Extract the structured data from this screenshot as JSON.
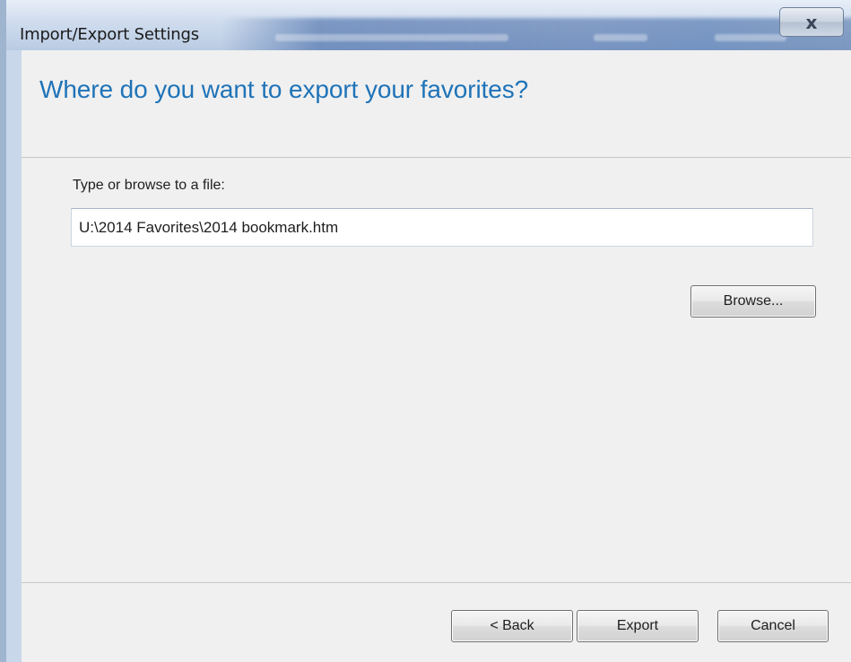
{
  "window": {
    "title": "Import/Export Settings",
    "close_glyph": "x"
  },
  "header": {
    "heading": "Where do you want to export your favorites?"
  },
  "form": {
    "label": "Type or browse to a file:",
    "path_value": "U:\\2014 Favorites\\2014 bookmark.htm",
    "browse_label": "Browse..."
  },
  "footer": {
    "back_label": "< Back",
    "export_label": "Export",
    "cancel_label": "Cancel"
  },
  "colors": {
    "heading": "#1f73b8",
    "title_bar": "#cfdcee",
    "dialog_bg": "#f0f0f0"
  },
  "icons": {
    "close": "close-icon"
  }
}
